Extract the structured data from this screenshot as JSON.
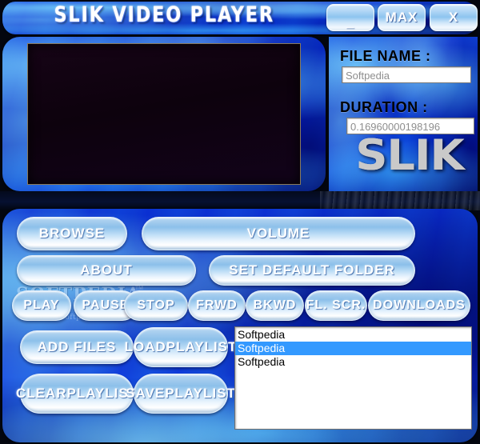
{
  "window": {
    "title": "SLIK VIDEO PLAYER",
    "controls": {
      "minimize": "_",
      "maximize": "MAX",
      "close": "X"
    }
  },
  "info": {
    "filename_label": "FILE NAME :",
    "filename_value": "Softpedia",
    "duration_label": "DURATION :",
    "duration_value": "0.16960000198196",
    "logo": "SLIK"
  },
  "watermark": {
    "main": "SOFTPEDIA",
    "tm": "TM",
    "sub": "www.softpedia.com"
  },
  "buttons": {
    "browse": "BROWSE",
    "volume": "VOLUME",
    "about": "ABOUT",
    "set_default_folder": "SET DEFAULT FOLDER",
    "play": "PLAY",
    "pause": "PAUSE",
    "stop": "STOP",
    "frwd": "FRWD",
    "bkwd": "BKWD",
    "fl_scr": "FL. SCR.",
    "downloads": "DOWNLOADS",
    "add_files": "ADD FILES",
    "load_playlist": "LOAD\nPLAYLIST",
    "clear_playlist": "CLEAR\nPLAYLIST",
    "save_playlist": "SAVE\nPLAYLIST"
  },
  "playlist": {
    "items": [
      {
        "label": "Softpedia",
        "selected": false
      },
      {
        "label": "Softpedia",
        "selected": true
      },
      {
        "label": "Softpedia",
        "selected": false
      }
    ]
  },
  "colors": {
    "accent_blue": "#0b34c8",
    "panel_light": "#8cc0ea",
    "selection": "#3399ff",
    "screen": "#0d020d",
    "title_text": "#ffffff",
    "label_text": "#000000",
    "field_text": "#8e8e8e"
  }
}
